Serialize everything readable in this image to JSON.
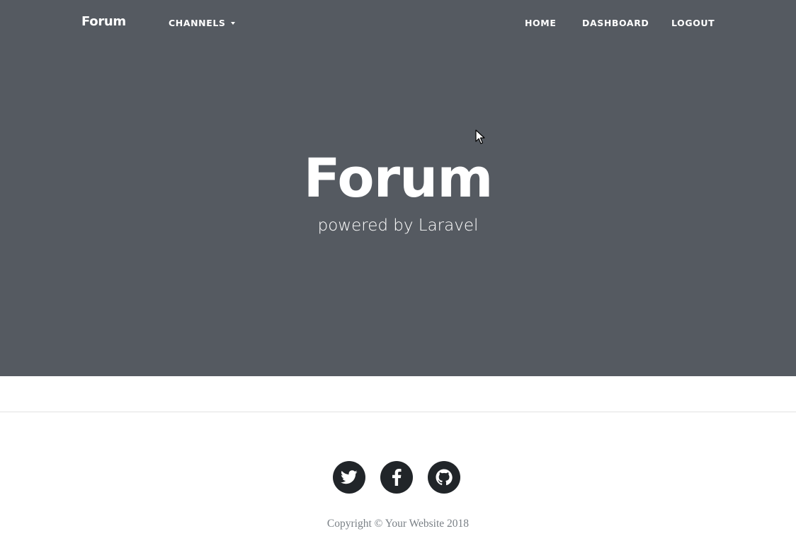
{
  "navbar": {
    "brand": "Forum",
    "channels_label": "CHANNELS",
    "links": {
      "home": "HOME",
      "dashboard": "DASHBOARD",
      "logout": "LOGOUT"
    }
  },
  "hero": {
    "title": "Forum",
    "subtitle": "powered by Laravel"
  },
  "footer": {
    "social": [
      "twitter-icon",
      "facebook-icon",
      "github-icon"
    ],
    "copyright": "Copyright © Your Website 2018"
  },
  "colors": {
    "hero_background": "#555a61",
    "social_background": "#212529",
    "footer_text": "#7a8086"
  }
}
